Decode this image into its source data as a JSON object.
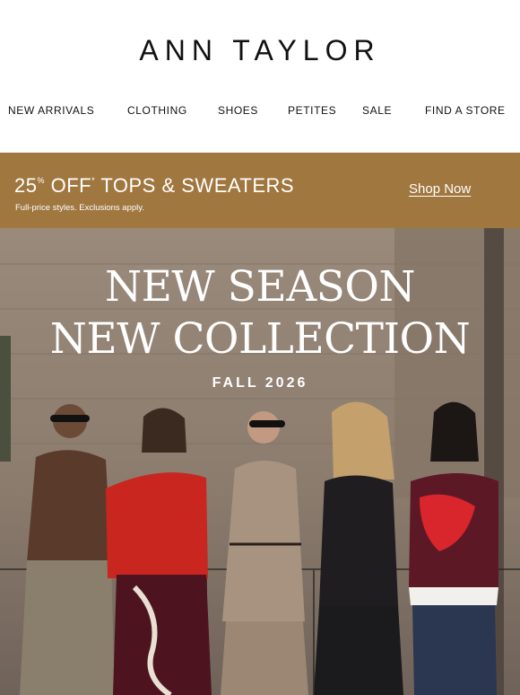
{
  "brand": {
    "logo": "ANN TAYLOR"
  },
  "nav": [
    "NEW ARRIVALS",
    "CLOTHING",
    "SHOES",
    "PETITES",
    "SALE",
    "FIND A STORE"
  ],
  "promo": {
    "percent": "25",
    "percent_sign": "%",
    "off": "OFF",
    "asterisk": "*",
    "category": "TOPS & SWEATERS",
    "fine_print": "Full-price styles. Exclusions apply.",
    "cta": "Shop Now",
    "background": "#a0773f"
  },
  "hero": {
    "line1": "NEW SEASON",
    "line2": "NEW COLLECTION",
    "subtitle": "FALL 2026",
    "image_description_icon": "group-photo"
  }
}
